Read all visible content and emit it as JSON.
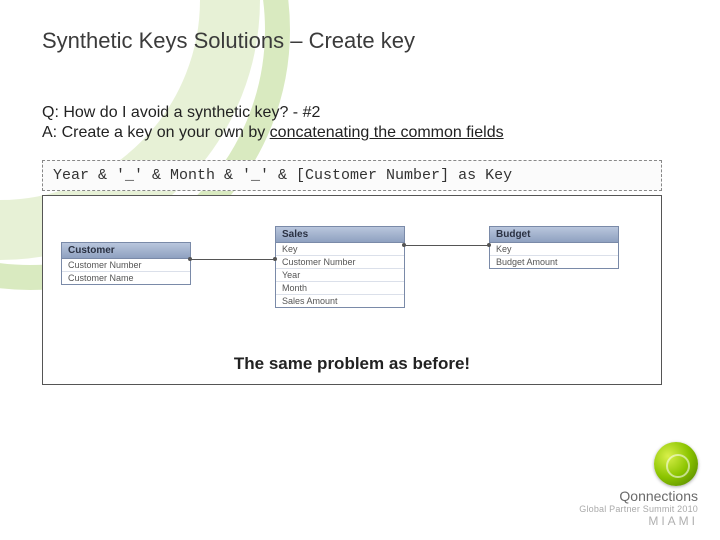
{
  "title": "Synthetic Keys Solutions – Create key",
  "question": {
    "prefix": "Q: ",
    "text": "How do I avoid a synthetic key? - #2"
  },
  "answer": {
    "prefix": "A: ",
    "lead": "Create a key on your own by ",
    "underlined": "concatenating the common fields"
  },
  "code": "Year & '_' & Month & '_' & [Customer Number] as Key",
  "diagram": {
    "tables": [
      {
        "name": "Customer",
        "fields": [
          "Customer Number",
          "Customer Name"
        ]
      },
      {
        "name": "Sales",
        "fields": [
          "Key",
          "Customer Number",
          "Year",
          "Month",
          "Sales Amount"
        ]
      },
      {
        "name": "Budget",
        "fields": [
          "Key",
          "Budget Amount"
        ]
      }
    ],
    "caption": "The same problem as before!"
  },
  "footer": {
    "brand": "Qonnections",
    "subtitle": "Global Partner Summit 2010",
    "location": "MIAMI"
  }
}
